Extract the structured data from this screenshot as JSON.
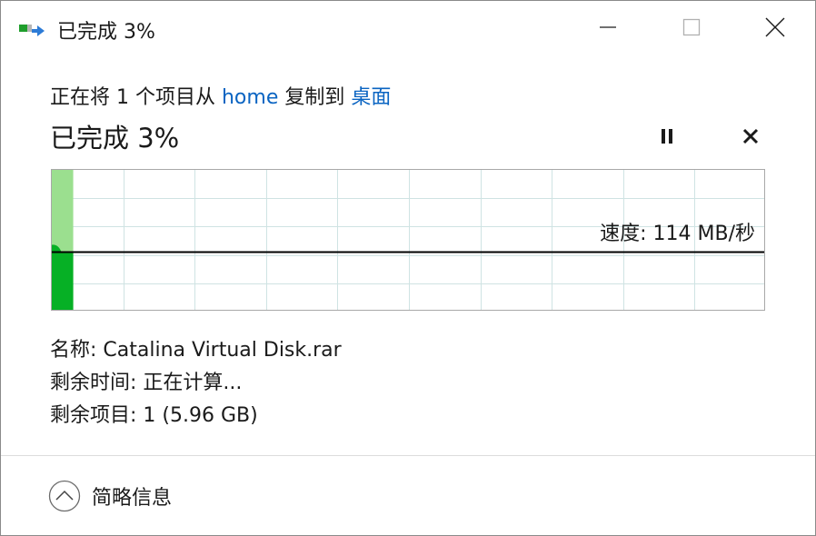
{
  "window": {
    "title": "已完成 3%",
    "icon": "copy-file-icon"
  },
  "controls": {
    "minimize": "minimize-icon",
    "maximize": "maximize-icon",
    "close": "close-icon"
  },
  "copy": {
    "prefix": "正在将 1 个项目从 ",
    "source": "home",
    "middle": " 复制到 ",
    "destination": "桌面"
  },
  "status": {
    "heading": "已完成 3%",
    "progress_percent": 3
  },
  "actions": {
    "pause": "pause-icon",
    "cancel": "cancel-icon"
  },
  "graph": {
    "speed_label": "速度: 114 MB/秒",
    "colors": {
      "fill_done": "#06b025",
      "fill_light": "#9bdf8f",
      "grid": "#cfe3e3",
      "speed_line": "#000000"
    }
  },
  "details": {
    "name": "名称: Catalina Virtual Disk.rar",
    "time_remaining": "剩余时间: 正在计算...",
    "items_remaining": "剩余项目: 1 (5.96 GB)"
  },
  "footer": {
    "toggle_label": "简略信息",
    "toggle_icon": "chevron-up-circle-icon"
  }
}
